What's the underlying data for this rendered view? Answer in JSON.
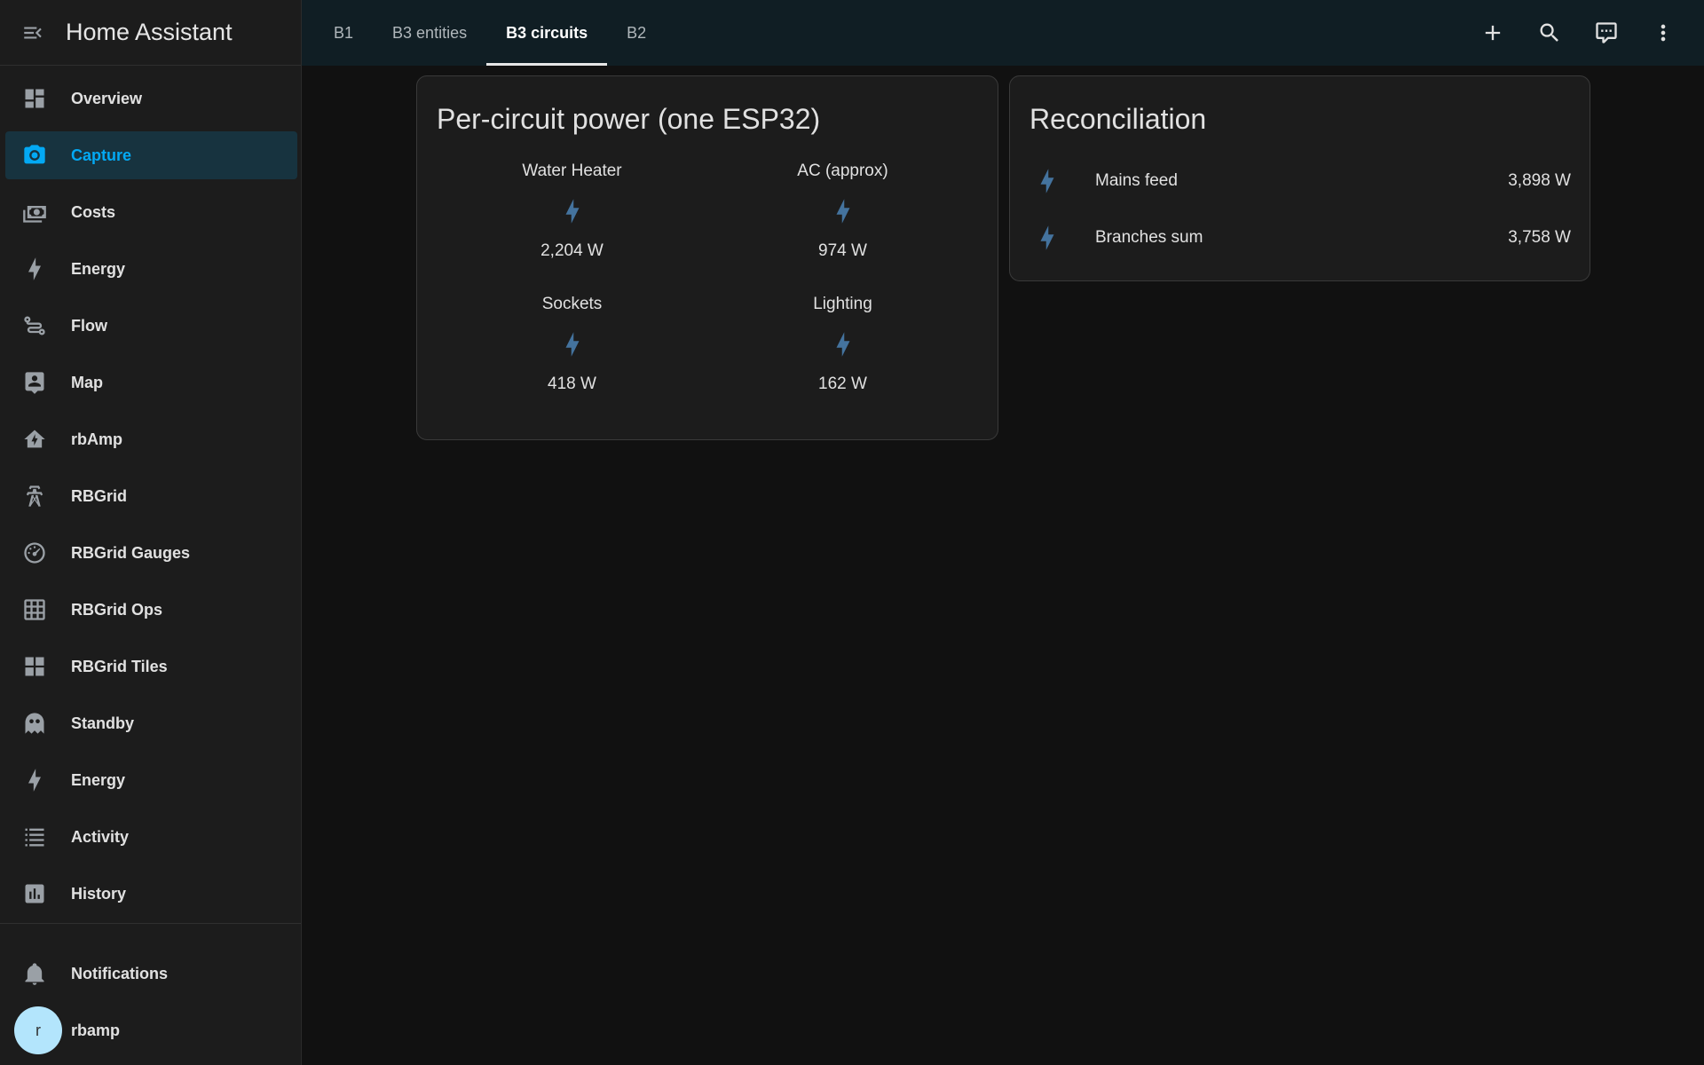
{
  "app": {
    "title": "Home Assistant"
  },
  "sidebar": {
    "items": [
      {
        "label": "Overview",
        "icon": "dashboard-icon"
      },
      {
        "label": "Capture",
        "icon": "camera-icon",
        "active": true
      },
      {
        "label": "Costs",
        "icon": "cash-icon"
      },
      {
        "label": "Energy",
        "icon": "lightning-icon"
      },
      {
        "label": "Flow",
        "icon": "flow-icon"
      },
      {
        "label": "Map",
        "icon": "map-account-icon"
      },
      {
        "label": "rbAmp",
        "icon": "home-lightning-icon"
      },
      {
        "label": "RBGrid",
        "icon": "transmission-tower-icon"
      },
      {
        "label": "RBGrid Gauges",
        "icon": "gauge-icon"
      },
      {
        "label": "RBGrid Ops",
        "icon": "grid-table-icon"
      },
      {
        "label": "RBGrid Tiles",
        "icon": "tiles-icon"
      },
      {
        "label": "Standby",
        "icon": "ghost-icon"
      },
      {
        "label": "Energy",
        "icon": "lightning-icon"
      },
      {
        "label": "Activity",
        "icon": "list-icon"
      },
      {
        "label": "History",
        "icon": "chart-box-icon"
      }
    ],
    "notifications_label": "Notifications",
    "user": {
      "name": "rbamp",
      "initial": "r"
    }
  },
  "topbar": {
    "tabs": [
      {
        "label": "B1"
      },
      {
        "label": "B3 entities"
      },
      {
        "label": "B3 circuits",
        "active": true
      },
      {
        "label": "B2"
      }
    ],
    "actions": [
      "plus-icon",
      "search-icon",
      "assist-icon",
      "more-vert-icon"
    ]
  },
  "circuits_card": {
    "title": "Per-circuit power (one ESP32)",
    "items": [
      {
        "name": "Water Heater",
        "value": "2,204 W"
      },
      {
        "name": "AC (approx)",
        "value": "974 W"
      },
      {
        "name": "Sockets",
        "value": "418 W"
      },
      {
        "name": "Lighting",
        "value": "162 W"
      }
    ]
  },
  "reconciliation_card": {
    "title": "Reconciliation",
    "rows": [
      {
        "name": "Mains feed",
        "value": "3,898 W"
      },
      {
        "name": "Branches sum",
        "value": "3,758 W"
      }
    ]
  },
  "colors": {
    "accent": "#03a9f4",
    "entity_icon": "#44739e",
    "background": "#111111",
    "card": "#1c1c1c"
  }
}
